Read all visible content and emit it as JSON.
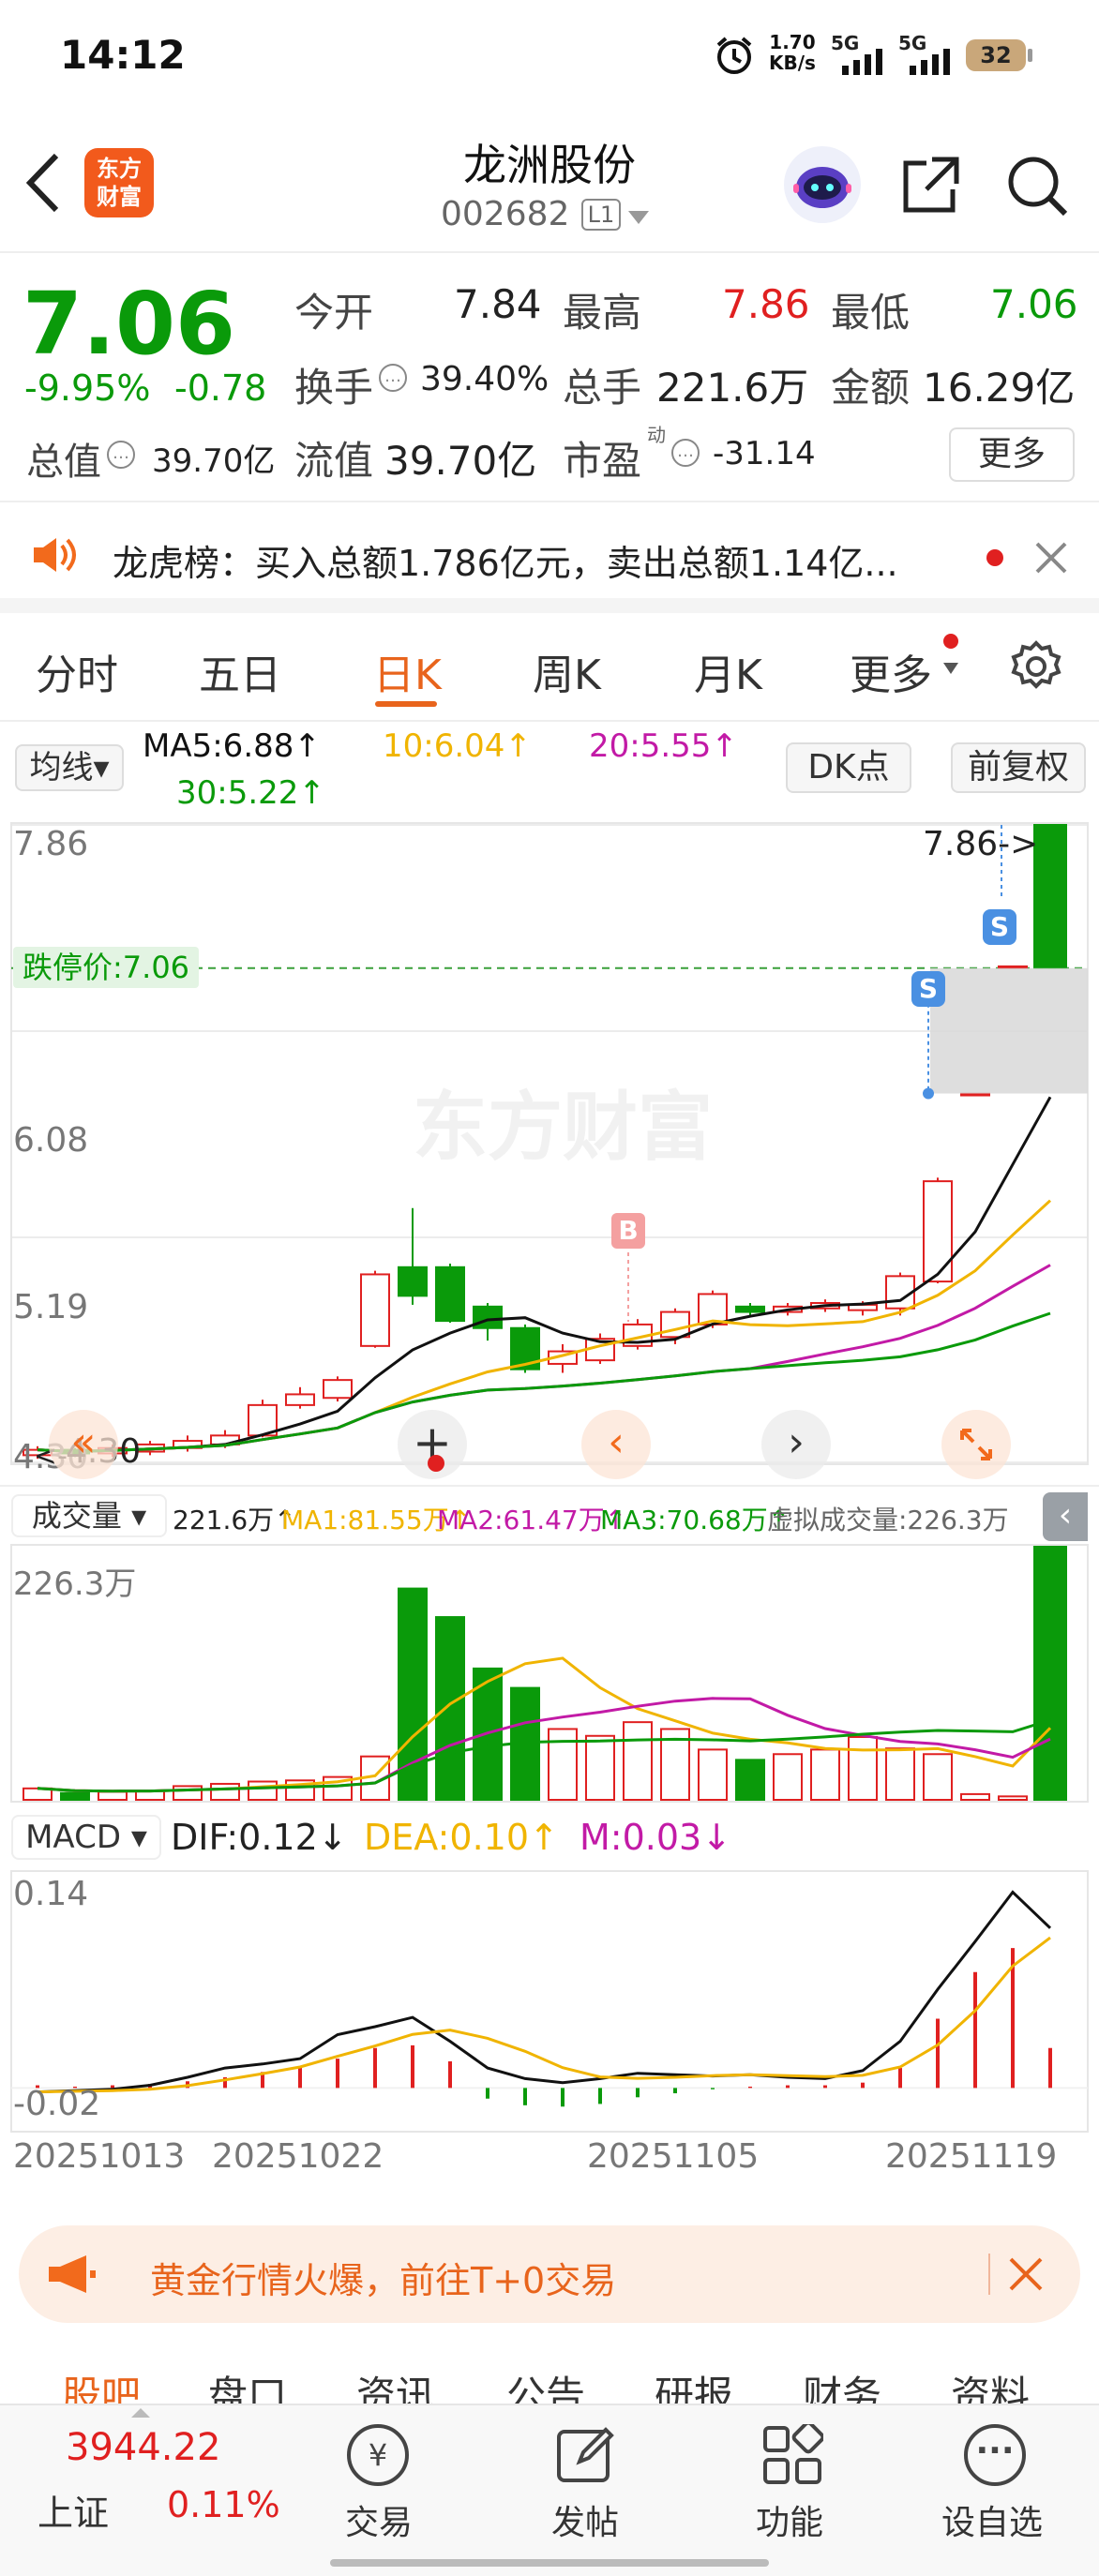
{
  "status_bar": {
    "time": "14:12",
    "net_speed_value": "1.70",
    "net_speed_unit": "KB/s",
    "sig1": "5G",
    "sig2": "5G",
    "battery": "32"
  },
  "header": {
    "stock_name": "龙洲股份",
    "stock_code": "002682",
    "level": "L1",
    "logo_line1": "东方",
    "logo_line2": "财富"
  },
  "quote": {
    "price": "7.06",
    "change_pct": "-9.95%",
    "change_abs": "-0.78",
    "market_cap_label": "总值",
    "market_cap": "39.70亿",
    "open_label": "今开",
    "open": "7.84",
    "high_label": "最高",
    "high": "7.86",
    "low_label": "最低",
    "low": "7.06",
    "turnover_rate_label": "换手",
    "turnover_rate": "39.40%",
    "volume_label": "总手",
    "volume": "221.6万",
    "amount_label": "金额",
    "amount": "16.29亿",
    "float_cap_label": "流值",
    "float_cap": "39.70亿",
    "pe_label": "市盈",
    "pe_sup": "动",
    "pe": "-31.14",
    "more_label": "更多"
  },
  "notice": {
    "text": "龙虎榜：买入总额1.786亿元，卖出总额1.14亿..."
  },
  "chart_tabs": [
    "分时",
    "五日",
    "日K",
    "周K",
    "月K",
    "更多"
  ],
  "ma_bar": {
    "selector": "均线",
    "ma5": "MA5:6.88↑",
    "ma10": "10:6.04↑",
    "ma20": "20:5.55↑",
    "ma30": "30:5.22↑",
    "dk": "DK点",
    "adjust": "前复权"
  },
  "kline": {
    "y_labels": [
      "7.86",
      "6.08",
      "5.19",
      "4.30"
    ],
    "high_marker": "7.86->",
    "limit_label": "跌停价:7.06",
    "low_marker": "4.30",
    "watermark": "东方财富",
    "b_marker": "B",
    "s_marker": "S"
  },
  "volume_bar": {
    "selector": "成交量",
    "total": "221.6万↑",
    "ma1": "MA1:81.55万↑",
    "ma2": "MA2:61.47万↑",
    "ma3": "MA3:70.68万↑",
    "virtual": "虚拟成交量:226.3万",
    "y_max": "226.3万"
  },
  "macd_bar": {
    "selector": "MACD",
    "dif": "DIF:0.12↓",
    "dea": "DEA:0.10↑",
    "m": "M:0.03↓",
    "y_max": "0.14",
    "y_min": "-0.02"
  },
  "dates": [
    "20251013",
    "20251022",
    "20251105",
    "20251119"
  ],
  "banner": {
    "text": "黄金行情火爆，前往T+0交易"
  },
  "sub_tabs": [
    "股吧",
    "盘口",
    "资讯",
    "公告",
    "研报",
    "财务",
    "资料"
  ],
  "bottom": {
    "index_value": "3944.22",
    "index_name": "上证",
    "index_change": "0.11%",
    "items": [
      "交易",
      "发帖",
      "功能",
      "设自选"
    ]
  },
  "colors": {
    "up": "#e02020",
    "down": "#0a9a0a",
    "accent": "#e8641c",
    "ma5": "#111111",
    "ma10": "#f0b400",
    "ma20": "#c21aa6",
    "ma30": "#0a9a0a"
  },
  "chart_data": {
    "type": "candlestick",
    "dates_shown": [
      "20251013",
      "20251022",
      "20251105",
      "20251119"
    ],
    "ylim": [
      4.3,
      7.86
    ],
    "candles": [
      {
        "o": 4.34,
        "c": 4.37,
        "h": 4.39,
        "l": 4.32
      },
      {
        "o": 4.37,
        "c": 4.35,
        "h": 4.38,
        "l": 4.33
      },
      {
        "o": 4.35,
        "c": 4.38,
        "h": 4.4,
        "l": 4.33
      },
      {
        "o": 4.36,
        "c": 4.4,
        "h": 4.42,
        "l": 4.34
      },
      {
        "o": 4.38,
        "c": 4.42,
        "h": 4.45,
        "l": 4.36
      },
      {
        "o": 4.4,
        "c": 4.45,
        "h": 4.48,
        "l": 4.38
      },
      {
        "o": 4.45,
        "c": 4.62,
        "h": 4.65,
        "l": 4.44
      },
      {
        "o": 4.62,
        "c": 4.68,
        "h": 4.72,
        "l": 4.6
      },
      {
        "o": 4.66,
        "c": 4.76,
        "h": 4.78,
        "l": 4.64
      },
      {
        "o": 4.95,
        "c": 5.35,
        "h": 5.37,
        "l": 4.94
      },
      {
        "o": 5.39,
        "c": 5.23,
        "h": 5.72,
        "l": 5.18
      },
      {
        "o": 5.39,
        "c": 5.09,
        "h": 5.41,
        "l": 5.08
      },
      {
        "o": 5.17,
        "c": 5.05,
        "h": 5.19,
        "l": 4.98
      },
      {
        "o": 5.05,
        "c": 4.82,
        "h": 5.07,
        "l": 4.8
      },
      {
        "o": 4.85,
        "c": 4.92,
        "h": 4.96,
        "l": 4.8
      },
      {
        "o": 4.87,
        "c": 4.99,
        "h": 5.02,
        "l": 4.85
      },
      {
        "o": 4.95,
        "c": 5.07,
        "h": 5.1,
        "l": 4.93
      },
      {
        "o": 5.0,
        "c": 5.14,
        "h": 5.16,
        "l": 4.96
      },
      {
        "o": 5.07,
        "c": 5.24,
        "h": 5.26,
        "l": 5.05
      },
      {
        "o": 5.17,
        "c": 5.14,
        "h": 5.19,
        "l": 5.11
      },
      {
        "o": 5.14,
        "c": 5.17,
        "h": 5.19,
        "l": 5.12
      },
      {
        "o": 5.16,
        "c": 5.19,
        "h": 5.21,
        "l": 5.14
      },
      {
        "o": 5.15,
        "c": 5.18,
        "h": 5.2,
        "l": 5.12
      },
      {
        "o": 5.16,
        "c": 5.34,
        "h": 5.36,
        "l": 5.12
      },
      {
        "o": 5.31,
        "c": 5.87,
        "h": 5.89,
        "l": 5.3
      },
      {
        "o": 6.36,
        "c": 6.36,
        "h": 6.36,
        "l": 6.36
      },
      {
        "o": 7.07,
        "c": 7.07,
        "h": 7.07,
        "l": 7.07
      },
      {
        "o": 7.86,
        "c": 7.06,
        "h": 7.86,
        "l": 7.06
      }
    ],
    "volume": [
      10,
      6,
      7,
      8,
      12,
      14,
      16,
      17,
      20,
      38,
      185,
      160,
      115,
      98,
      62,
      56,
      68,
      62,
      44,
      35,
      40,
      44,
      55,
      45,
      40,
      5,
      3,
      221.6
    ],
    "macd_hist": [
      0.002,
      0.001,
      0.002,
      0.003,
      0.005,
      0.008,
      0.012,
      0.016,
      0.022,
      0.03,
      0.032,
      0.02,
      -0.008,
      -0.013,
      -0.014,
      -0.012,
      -0.007,
      -0.004,
      -0.001,
      0.001,
      0.002,
      0.002,
      0.004,
      0.015,
      0.052,
      0.087,
      0.105,
      0.03
    ],
    "dif": [
      -0.003,
      -0.002,
      -0.001,
      0.002,
      0.008,
      0.015,
      0.018,
      0.022,
      0.04,
      0.046,
      0.053,
      0.035,
      0.015,
      0.007,
      0.004,
      0.007,
      0.011,
      0.01,
      0.009,
      0.01,
      0.008,
      0.007,
      0.013,
      0.035,
      0.074,
      0.11,
      0.147,
      0.12
    ]
  }
}
